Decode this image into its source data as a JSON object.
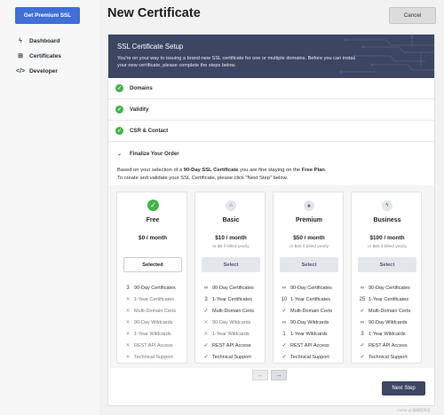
{
  "sidebar": {
    "premium_button": "Get Premium SSL",
    "items": [
      {
        "label": "Dashboard",
        "icon": "bolt-icon"
      },
      {
        "label": "Certificates",
        "icon": "grid-icon"
      },
      {
        "label": "Developer",
        "icon": "code-icon"
      }
    ]
  },
  "header": {
    "title": "New Certificate",
    "cancel_label": "Cancel"
  },
  "banner": {
    "title": "SSL Certificate Setup",
    "text": "You're on your way to issuing a brand-new SSL certificate for one or multiple domains. Before you can install your new certificate, please complete the steps below."
  },
  "steps": [
    {
      "label": "Domains",
      "status": "complete"
    },
    {
      "label": "Validity",
      "status": "complete"
    },
    {
      "label": "CSR & Contact",
      "status": "complete"
    },
    {
      "label": "Finalize Your Order",
      "status": "expanded"
    }
  ],
  "intro": {
    "line1_a": "Based on your selection of a ",
    "line1_b": "90-Day SSL Certificate",
    "line1_c": " you are fine staying on the ",
    "line1_d": "Free Plan",
    "line1_e": ".",
    "line2": "To create and validate your SSL Certificate, please click \"Next Step\" below."
  },
  "plans": [
    {
      "name": "Free",
      "price": "$0 / month",
      "yearly": "",
      "button": "Selected",
      "selected": true,
      "icon": "check-icon",
      "features": [
        {
          "mark": "3",
          "label": "90-Day Certificates",
          "on": true
        },
        {
          "mark": "✕",
          "label": "1-Year Certificates",
          "on": false
        },
        {
          "mark": "✕",
          "label": "Multi-Domain Certs",
          "on": false
        },
        {
          "mark": "✕",
          "label": "90-Day Wildcards",
          "on": false
        },
        {
          "mark": "✕",
          "label": "1-Year Wildcards",
          "on": false
        },
        {
          "mark": "✕",
          "label": "REST API Access",
          "on": false
        },
        {
          "mark": "✕",
          "label": "Technical Support",
          "on": false
        }
      ]
    },
    {
      "name": "Basic",
      "price": "$10 / month",
      "yearly": "or $8 if billed yearly",
      "button": "Select",
      "selected": false,
      "icon": "home-icon",
      "features": [
        {
          "mark": "∞",
          "label": "90-Day Certificates",
          "on": true
        },
        {
          "mark": "3",
          "label": "1-Year Certificates",
          "on": true
        },
        {
          "mark": "✓",
          "label": "Multi-Domain Certs",
          "on": true
        },
        {
          "mark": "✕",
          "label": "90-Day Wildcards",
          "on": false
        },
        {
          "mark": "✕",
          "label": "1-Year Wildcards",
          "on": false
        },
        {
          "mark": "✓",
          "label": "REST API Access",
          "on": true
        },
        {
          "mark": "✓",
          "label": "Technical Support",
          "on": true
        }
      ]
    },
    {
      "name": "Premium",
      "price": "$50 / month",
      "yearly": "or $40 if billed yearly",
      "button": "Select",
      "selected": false,
      "icon": "star-icon",
      "features": [
        {
          "mark": "∞",
          "label": "90-Day Certificates",
          "on": true
        },
        {
          "mark": "10",
          "label": "1-Year Certificates",
          "on": true
        },
        {
          "mark": "✓",
          "label": "Multi-Domain Certs",
          "on": true
        },
        {
          "mark": "∞",
          "label": "90-Day Wildcards",
          "on": true
        },
        {
          "mark": "1",
          "label": "1-Year Wildcards",
          "on": true
        },
        {
          "mark": "✓",
          "label": "REST API Access",
          "on": true
        },
        {
          "mark": "✓",
          "label": "Technical Support",
          "on": true
        }
      ]
    },
    {
      "name": "Business",
      "price": "$100 / month",
      "yearly": "or $80 if billed yearly",
      "button": "Select",
      "selected": false,
      "icon": "lightning-icon",
      "features": [
        {
          "mark": "∞",
          "label": "90-Day Certificates",
          "on": true
        },
        {
          "mark": "25",
          "label": "1-Year Certificates",
          "on": true
        },
        {
          "mark": "✓",
          "label": "Multi-Domain Certs",
          "on": true
        },
        {
          "mark": "∞",
          "label": "90-Day Wildcards",
          "on": true
        },
        {
          "mark": "3",
          "label": "1-Year Wildcards",
          "on": true
        },
        {
          "mark": "✓",
          "label": "REST API Access",
          "on": true
        },
        {
          "mark": "✓",
          "label": "Technical Support",
          "on": true
        }
      ]
    }
  ],
  "carousel": {
    "prev": "←",
    "next": "→"
  },
  "next_step_label": "Next Step",
  "watermark": "CSDN @ 猿圈程序员",
  "colors": {
    "primary": "#3f6fd8",
    "banner": "#3c4663",
    "success": "#45b34d"
  }
}
